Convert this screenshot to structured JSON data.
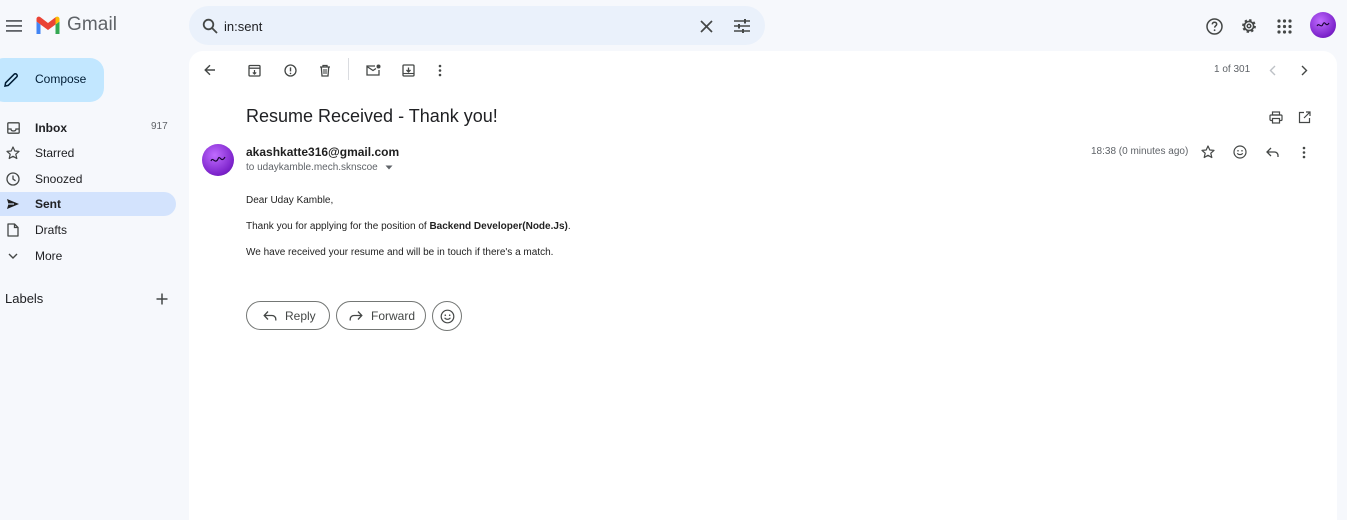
{
  "app": {
    "name": "Gmail"
  },
  "search": {
    "query": "in:sent"
  },
  "compose": {
    "label": "Compose"
  },
  "sidebar": {
    "items": [
      {
        "label": "Inbox",
        "count": "917",
        "icon": "inbox-icon"
      },
      {
        "label": "Starred",
        "count": "",
        "icon": "star-icon"
      },
      {
        "label": "Snoozed",
        "count": "",
        "icon": "clock-icon"
      },
      {
        "label": "Sent",
        "count": "",
        "icon": "send-icon",
        "active": true
      },
      {
        "label": "Drafts",
        "count": "",
        "icon": "draft-icon"
      },
      {
        "label": "More",
        "count": "",
        "icon": "chevron-down-icon"
      }
    ],
    "labels_title": "Labels"
  },
  "toolbar": {
    "pager": "1 of 301"
  },
  "message": {
    "subject": "Resume Received - Thank you!",
    "sender_email": "akashkatte316@gmail.com",
    "to_line": "to udaykamble.mech.sknscoe",
    "time": "18:38 (0 minutes ago)",
    "greeting": "Dear Uday Kamble,",
    "line1_prefix": "Thank you for applying for the position of ",
    "line1_position": "Backend Developer(Node.Js)",
    "line1_suffix": ".",
    "line2": "We have received your resume and will be in touch if there's a match."
  },
  "actions": {
    "reply_label": "Reply",
    "forward_label": "Forward"
  },
  "colors": {
    "background": "#f6f8fc",
    "compose": "#c2e7ff",
    "active_nav": "#d3e3fd",
    "search": "#eaf1fb",
    "gmail_red": "#ea4335"
  }
}
